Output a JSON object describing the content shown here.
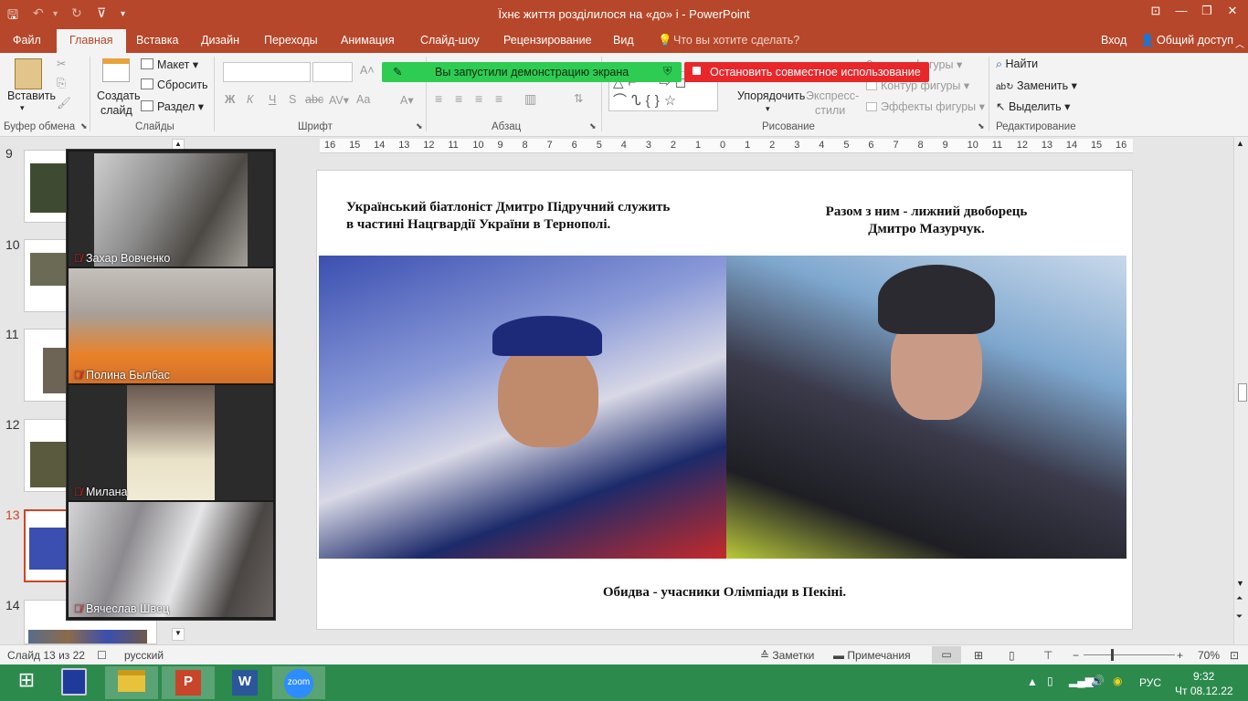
{
  "titlebar": {
    "title": "Їхнє життя розділилося на «до» і - PowerPoint"
  },
  "tabs": {
    "file": "Файл",
    "home": "Главная",
    "insert": "Вставка",
    "design": "Дизайн",
    "transitions": "Переходы",
    "animation": "Анимация",
    "slideshow": "Слайд-шоу",
    "review": "Рецензирование",
    "view": "Вид",
    "tellme": "Что вы хотите сделать?",
    "signin": "Вход",
    "share": "Общий доступ"
  },
  "ribbon": {
    "paste": "Вставить",
    "clipboard": "Буфер обмена",
    "new_slide": "Создать",
    "new_slide2": "слайд",
    "layout": "Макет",
    "reset": "Сбросить",
    "section": "Раздел",
    "slides": "Слайды",
    "font": "Шрифт",
    "paragraph": "Абзац",
    "arrange": "Упорядочить",
    "quick_styles": "Экспресс-",
    "quick_styles2": "стили",
    "shape_fill": "Заливка фигуры",
    "shape_outline": "Контур фигуры",
    "shape_effects": "Эффекты фигуры",
    "drawing": "Рисование",
    "find": "Найти",
    "replace": "Заменить",
    "select": "Выделить",
    "editing": "Редактирование",
    "bold": "Ж",
    "italic": "К",
    "underline": "Ч",
    "strike": "S",
    "spacing": "abc",
    "case": "Aa"
  },
  "banners": {
    "green": "Вы запустили демонстрацию экрана",
    "red": "Остановить совместное использование"
  },
  "thumbnails": [
    {
      "num": "9"
    },
    {
      "num": "10"
    },
    {
      "num": "11"
    },
    {
      "num": "12"
    },
    {
      "num": "13"
    },
    {
      "num": "14"
    }
  ],
  "gallery": [
    {
      "name": "Захар Вовченко"
    },
    {
      "name": "Полина Былбас"
    },
    {
      "name": "Милана"
    },
    {
      "name": "Вячеслав Швец"
    }
  ],
  "ruler": [
    "16",
    "15",
    "14",
    "13",
    "12",
    "11",
    "10",
    "9",
    "8",
    "7",
    "6",
    "5",
    "4",
    "3",
    "2",
    "1",
    "0",
    "1",
    "2",
    "3",
    "4",
    "5",
    "6",
    "7",
    "8",
    "9",
    "10",
    "11",
    "12",
    "13",
    "14",
    "15",
    "16"
  ],
  "slide": {
    "left_text_1": "Український біатлоніст Дмитро Підручний служить",
    "left_text_2": "в частині Нацгвардії України в Тернополі.",
    "right_text_1": "Разом з ним - лижний двоборець",
    "right_text_2": "Дмитро Мазурчук.",
    "bottom_text": "Обидва - учасники Олімпіади в Пекіні."
  },
  "status": {
    "slide_of": "Слайд 13 из 22",
    "language": "русский",
    "notes": "Заметки",
    "comments": "Примечания",
    "zoom": "70%"
  },
  "taskbar": {
    "zoom_app": "zoom",
    "lang": "РУС",
    "time": "9:32",
    "date": "Чт 08.12.22"
  },
  "colors": {
    "accent": "#b7472a",
    "taskbar": "#2c8a4d",
    "banner_green": "#2ecc52",
    "banner_red": "#e8272b"
  }
}
